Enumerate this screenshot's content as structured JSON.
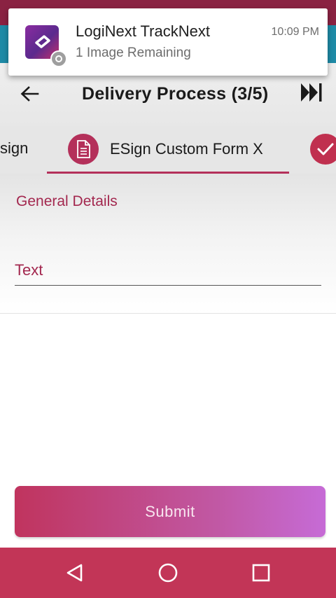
{
  "notification": {
    "app_name": "LogiNext TrackNext",
    "time": "10:09 PM",
    "message": "1 Image Remaining"
  },
  "app_bar": {
    "title": "Delivery Process (3/5)",
    "back_icon": "arrow-left-icon",
    "skip_icon": "skip-to-end-icon"
  },
  "tabs": {
    "previous_label": "sign",
    "current": {
      "label": "ESign Custom Form X",
      "icon": "document-icon"
    },
    "next_icon": "checkmark-icon"
  },
  "form": {
    "section_title": "General Details",
    "text_field_label": "Text"
  },
  "submit_label": "Submit",
  "nav": {
    "back_icon": "triangle-back-icon",
    "home_icon": "circle-home-icon",
    "recents_icon": "square-recents-icon"
  },
  "colors": {
    "accent": "#b4305a",
    "nav_bar": "#c23557",
    "status_bar": "#8a2242",
    "submit_gradient_start": "#c0345e",
    "submit_gradient_end": "#c66bd6"
  }
}
